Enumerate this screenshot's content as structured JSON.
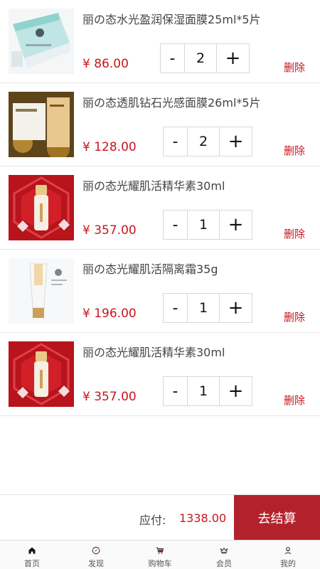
{
  "cart": {
    "items": [
      {
        "title": "丽の态水光盈润保湿面膜25ml*5片",
        "price": "¥ 86.00",
        "quantity": "2",
        "delete_label": "删除",
        "image": "product-image-hydrating-mask"
      },
      {
        "title": "丽の态透肌钻石光感面膜26ml*5片",
        "price": "¥ 128.00",
        "quantity": "2",
        "delete_label": "删除",
        "image": "product-image-diamond-mask"
      },
      {
        "title": "丽の态光耀肌活精华素30ml",
        "price": "¥ 357.00",
        "quantity": "1",
        "delete_label": "删除",
        "image": "product-image-essence"
      },
      {
        "title": "丽の态光耀肌活隔离霜35g",
        "price": "¥ 196.00",
        "quantity": "1",
        "delete_label": "删除",
        "image": "product-image-primer"
      },
      {
        "title": "丽の态光耀肌活精华素30ml",
        "price": "¥ 357.00",
        "quantity": "1",
        "delete_label": "删除",
        "image": "product-image-essence"
      }
    ],
    "minus_label": "-",
    "plus_label": "+"
  },
  "checkout": {
    "total_label": "应付:",
    "total_amount": "1338.00",
    "button_label": "去结算"
  },
  "tabbar": {
    "tabs": [
      {
        "icon": "home-icon",
        "label": "首页"
      },
      {
        "icon": "compass-icon",
        "label": "发现"
      },
      {
        "icon": "cart-icon",
        "label": "购物车"
      },
      {
        "icon": "crown-icon",
        "label": "会员"
      },
      {
        "icon": "user-icon",
        "label": "我的"
      }
    ]
  },
  "colors": {
    "price": "#c8161d",
    "checkout_button": "#b3222c",
    "active_tab": "#b3222c"
  }
}
